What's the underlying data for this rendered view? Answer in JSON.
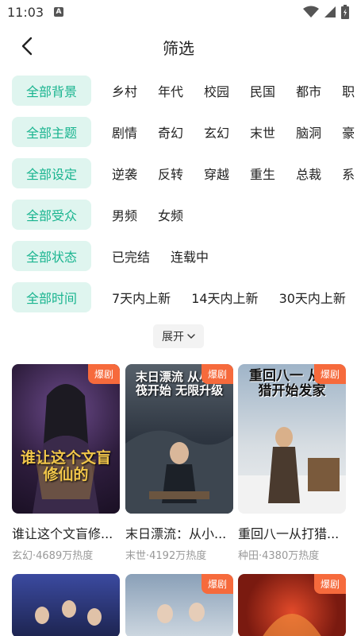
{
  "status_bar": {
    "time": "11:03",
    "notif_icon": "A"
  },
  "header": {
    "title": "筛选"
  },
  "filters": [
    {
      "active": "全部背景",
      "options": [
        "乡村",
        "年代",
        "校园",
        "民国",
        "都市",
        "职"
      ]
    },
    {
      "active": "全部主题",
      "options": [
        "剧情",
        "奇幻",
        "玄幻",
        "末世",
        "脑洞",
        "豪"
      ]
    },
    {
      "active": "全部设定",
      "options": [
        "逆袭",
        "反转",
        "穿越",
        "重生",
        "总裁",
        "系"
      ]
    },
    {
      "active": "全部受众",
      "options": [
        "男频",
        "女频"
      ]
    },
    {
      "active": "全部状态",
      "options": [
        "已完结",
        "连载中"
      ]
    },
    {
      "active": "全部时间",
      "options": [
        "7天内上新",
        "14天内上新",
        "30天内上新"
      ]
    }
  ],
  "expand": {
    "label": "展开"
  },
  "cards": [
    {
      "title": "谁让这个文盲修...",
      "meta": "玄幻·4689万热度",
      "badge": "爆剧",
      "cover_text": "谁让这个文盲修仙的"
    },
    {
      "title": "末日漂流：从小...",
      "meta": "末世·4192万热度",
      "badge": "爆剧",
      "cover_text": "末日漂流 从小木筏开始 无限升级"
    },
    {
      "title": "重回八一从打猎...",
      "meta": "种田·4380万热度",
      "badge": "爆剧",
      "cover_text": "重回八一 从打猎开始发家"
    },
    {
      "badge": ""
    },
    {
      "badge": "爆剧"
    },
    {
      "badge": "爆剧"
    }
  ],
  "colors": {
    "accent": "#19b48f",
    "accent_bg": "#dff5ef",
    "badge": "#f66a3c"
  }
}
